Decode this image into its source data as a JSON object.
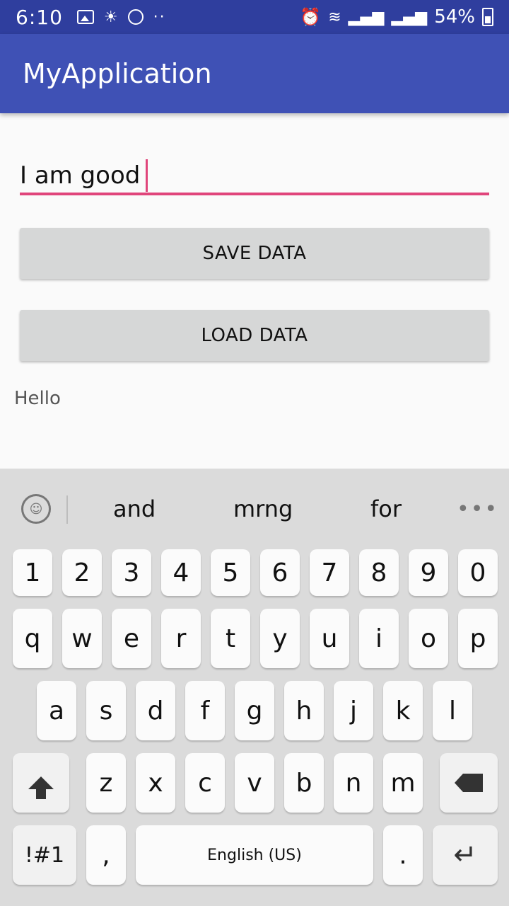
{
  "status_bar": {
    "time": "6:10",
    "battery": "54%"
  },
  "app_bar": {
    "title": "MyApplication"
  },
  "form": {
    "input_value": "I am good",
    "save_label": "SAVE DATA",
    "load_label": "LOAD DATA",
    "output_text": "Hello"
  },
  "keyboard": {
    "suggestions": [
      "and",
      "mrng",
      "for"
    ],
    "row_numbers": [
      "1",
      "2",
      "3",
      "4",
      "5",
      "6",
      "7",
      "8",
      "9",
      "0"
    ],
    "row_1": [
      "q",
      "w",
      "e",
      "r",
      "t",
      "y",
      "u",
      "i",
      "o",
      "p"
    ],
    "row_2": [
      "a",
      "s",
      "d",
      "f",
      "g",
      "h",
      "j",
      "k",
      "l"
    ],
    "row_3": [
      "z",
      "x",
      "c",
      "v",
      "b",
      "n",
      "m"
    ],
    "symbols_label": "!#1",
    "comma": ",",
    "space_label": "English (US)",
    "period": "."
  },
  "colors": {
    "status_bar": "#2f3e9e",
    "app_bar": "#3f51b5",
    "accent": "#e0457b",
    "button_bg": "#d6d7d7",
    "keyboard_bg": "#dbdbdb"
  }
}
